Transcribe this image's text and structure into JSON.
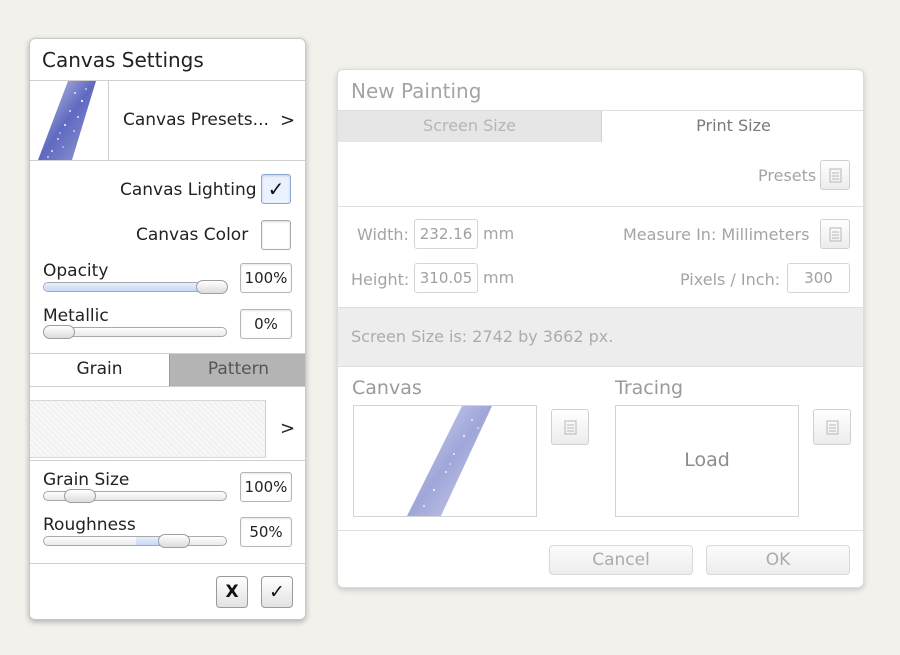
{
  "canvas_settings": {
    "title": "Canvas Settings",
    "presets_label": "Canvas Presets...",
    "presets_arrow": ">",
    "lighting_label": "Canvas Lighting",
    "lighting_check": "✓",
    "lighting_checked": true,
    "color_label": "Canvas Color",
    "opacity_label": "Opacity",
    "opacity_value": "100%",
    "opacity_level": 0.92,
    "metallic_label": "Metallic",
    "metallic_value": "0%",
    "metallic_level": 0.0,
    "tab_grain": "Grain",
    "tab_pattern": "Pattern",
    "grain_arrow": ">",
    "grain_size_label": "Grain Size",
    "grain_size_value": "100%",
    "roughness_label": "Roughness",
    "roughness_value": "50%",
    "cancel_label": "X",
    "confirm_label": "✓"
  },
  "new_painting": {
    "title": "New Painting",
    "tab_screen": "Screen Size",
    "tab_print": "Print Size",
    "presets_label": "Presets",
    "width_label": "Width:",
    "width_value": "232.16",
    "width_unit": "mm",
    "height_label": "Height:",
    "height_value": "310.05",
    "height_unit": "mm",
    "measure_label": "Measure In: Millimeters",
    "ppi_label": "Pixels / Inch:",
    "ppi_value": "300",
    "screen_size_text": "Screen Size is: 2742 by 3662 px.",
    "canvas_label": "Canvas",
    "tracing_label": "Tracing",
    "load_label": "Load",
    "cancel_label": "Cancel",
    "ok_label": "OK"
  },
  "colors": {
    "tab_inactive": "#b4b4b4",
    "slider_fill": "#c6d8f5",
    "background": "#f3f1ec"
  }
}
